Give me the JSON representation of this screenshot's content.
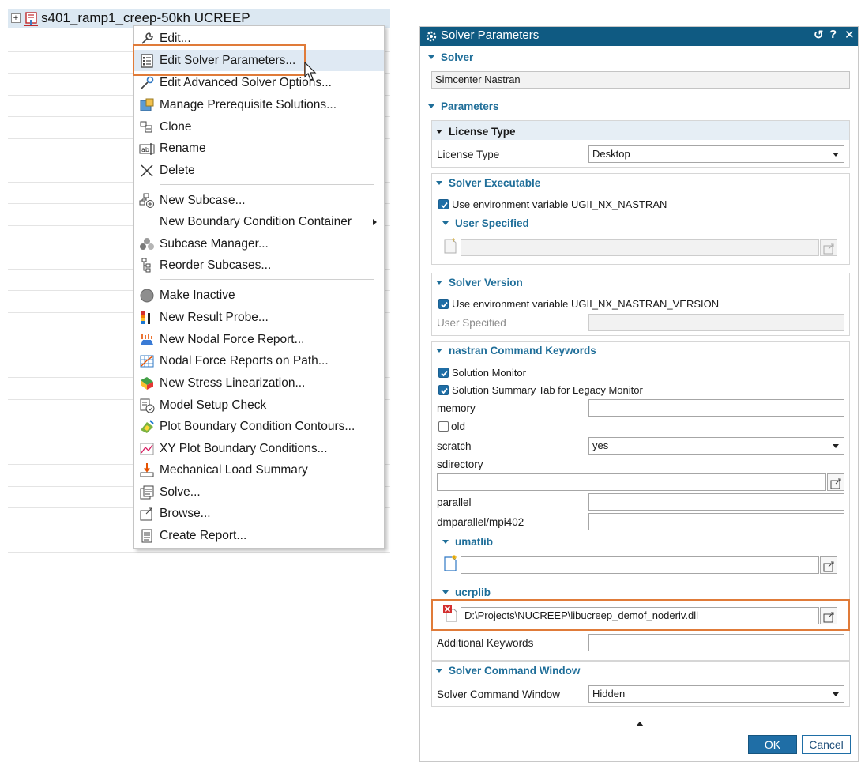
{
  "tree": {
    "expander": "+",
    "title": "s401_ramp1_creep-50kh UCREEP"
  },
  "context_menu": {
    "items": [
      {
        "label": "Edit...",
        "icon": "wrench-icon"
      },
      {
        "label": "Edit Solver Parameters...",
        "icon": "parameters-list-icon",
        "highlighted": true
      },
      {
        "label": "Edit Advanced Solver Options...",
        "icon": "advanced-wrench-icon"
      },
      {
        "label": "Manage Prerequisite Solutions...",
        "icon": "prerequisite-icon"
      },
      {
        "label": "Clone",
        "icon": "clone-icon"
      },
      {
        "label": "Rename",
        "icon": "rename-icon"
      },
      {
        "label": "Delete",
        "icon": "delete-icon"
      },
      {
        "label": "New Subcase...",
        "icon": "new-subcase-icon"
      },
      {
        "label": "New Boundary Condition Container",
        "icon": "none",
        "submenu": true
      },
      {
        "label": "Subcase Manager...",
        "icon": "subcase-manager-icon"
      },
      {
        "label": "Reorder Subcases...",
        "icon": "reorder-icon"
      },
      {
        "label": "Make Inactive",
        "icon": "inactive-circle-icon"
      },
      {
        "label": "New Result Probe...",
        "icon": "result-probe-icon"
      },
      {
        "label": "New Nodal Force Report...",
        "icon": "nodal-force-icon"
      },
      {
        "label": "Nodal Force Reports on Path...",
        "icon": "nodal-path-icon"
      },
      {
        "label": "New Stress Linearization...",
        "icon": "stress-linearization-icon"
      },
      {
        "label": "Model Setup Check",
        "icon": "model-check-icon"
      },
      {
        "label": "Plot Boundary Condition Contours...",
        "icon": "plot-contours-icon"
      },
      {
        "label": "XY Plot Boundary Conditions...",
        "icon": "xy-plot-icon"
      },
      {
        "label": "Mechanical Load Summary",
        "icon": "load-summary-icon"
      },
      {
        "label": "Solve...",
        "icon": "solve-icon"
      },
      {
        "label": "Browse...",
        "icon": "browse-icon"
      },
      {
        "label": "Create Report...",
        "icon": "report-icon"
      }
    ]
  },
  "dialog": {
    "title": "Solver Parameters",
    "title_buttons": [
      "↺",
      "?",
      "✕"
    ],
    "solver_section": "Solver",
    "solver_value": "Simcenter Nastran",
    "parameters_section": "Parameters",
    "license": {
      "header": "License Type",
      "label": "License Type",
      "value": "Desktop"
    },
    "executable": {
      "header": "Solver Executable",
      "env_checkbox": "Use environment variable UGII_NX_NASTRAN",
      "user_specified_header": "User Specified"
    },
    "version": {
      "header": "Solver Version",
      "env_checkbox": "Use environment variable UGII_NX_NASTRAN_VERSION",
      "user_specified_label": "User Specified"
    },
    "keywords": {
      "header": "nastran Command Keywords",
      "solution_monitor": "Solution Monitor",
      "summary_tab": "Solution Summary Tab for Legacy Monitor",
      "memory_label": "memory",
      "memory_value": "",
      "old_label": "old",
      "scratch_label": "scratch",
      "scratch_value": "yes",
      "sdirectory_label": "sdirectory",
      "sdirectory_value": "",
      "parallel_label": "parallel",
      "parallel_value": "",
      "dmparallel_label": "dmparallel/mpi402",
      "dmparallel_value": "",
      "umatlib_header": "umatlib",
      "umatlib_value": "",
      "ucrplib_header": "ucrplib",
      "ucrplib_value": "D:\\Projects\\NUCREEP\\libucreep_demof_noderiv.dll",
      "additional_label": "Additional Keywords",
      "additional_value": ""
    },
    "command_window": {
      "header": "Solver Command Window",
      "label": "Solver Command Window",
      "value": "Hidden"
    },
    "ok": "OK",
    "cancel": "Cancel"
  },
  "colors": {
    "accent": "#1f6e99",
    "titlebar": "#0f5a82",
    "highlight_box": "#e07b39",
    "menu_highlight": "#dfe9f3"
  }
}
